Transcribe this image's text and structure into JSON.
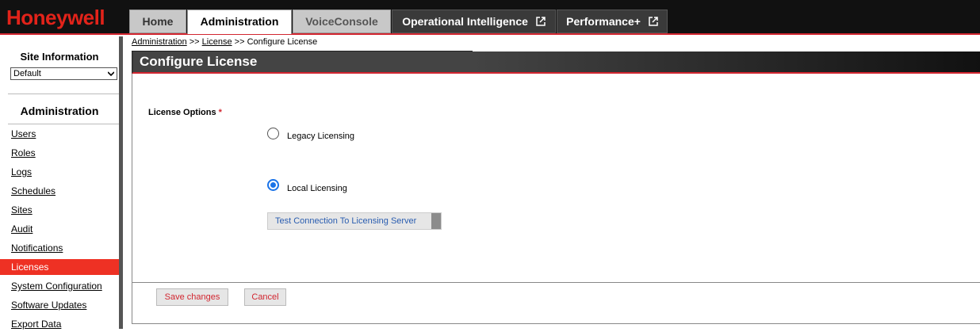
{
  "brand": {
    "logo_text": "Honeywell",
    "accent_color": "#e2231a"
  },
  "tabs": {
    "home": "Home",
    "administration": "Administration",
    "voiceconsole": "VoiceConsole",
    "operational_intelligence": "Operational Intelligence",
    "performance_plus": "Performance+"
  },
  "sidebar": {
    "site_info_title": "Site Information",
    "site_select_value": "Default",
    "admin_title": "Administration",
    "items": [
      {
        "label": "Users"
      },
      {
        "label": "Roles"
      },
      {
        "label": "Logs"
      },
      {
        "label": "Schedules"
      },
      {
        "label": "Sites"
      },
      {
        "label": "Audit"
      },
      {
        "label": "Notifications"
      },
      {
        "label": "Licenses",
        "active": true
      },
      {
        "label": "System Configuration"
      },
      {
        "label": "Software Updates"
      },
      {
        "label": "Export Data"
      }
    ]
  },
  "breadcrumb": {
    "part1": "Administration",
    "sep1": " >> ",
    "part2": "License",
    "sep2": " >> ",
    "current": "Configure License"
  },
  "page": {
    "title": "Configure License",
    "license_options_label": "License Options",
    "required_marker": "*",
    "options": [
      {
        "label": "Legacy Licensing",
        "selected": false
      },
      {
        "label": "Local Licensing",
        "selected": true
      }
    ],
    "test_connection_label": "Test Connection To Licensing Server"
  },
  "footer": {
    "save_label": "Save changes",
    "cancel_label": "Cancel"
  }
}
